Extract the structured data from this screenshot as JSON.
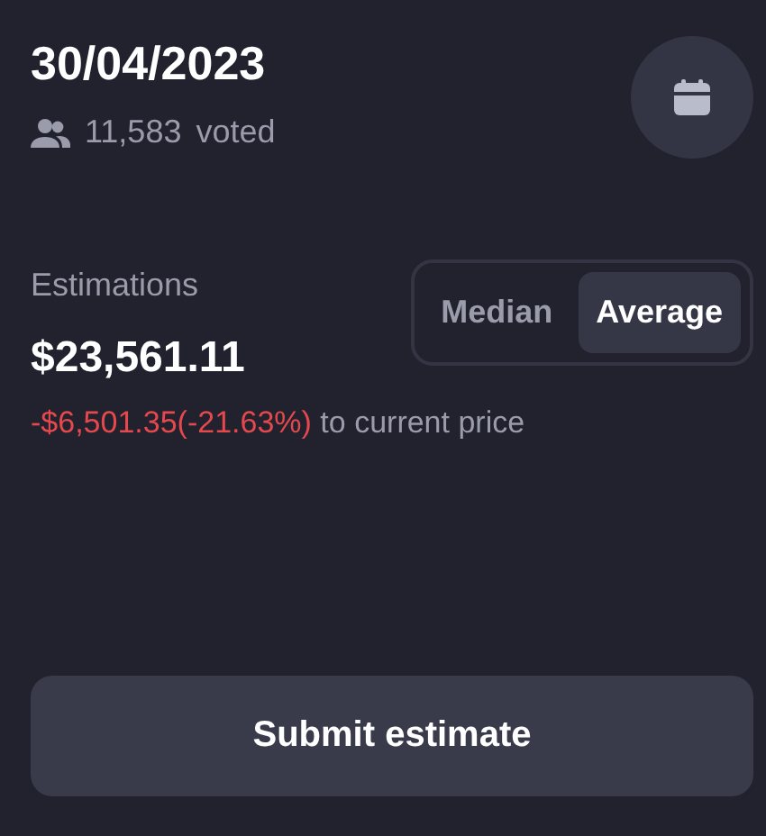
{
  "date": "30/04/2023",
  "voters": {
    "count": "11,583",
    "label": "voted"
  },
  "estimations": {
    "label": "Estimations",
    "value": "$23,561.11",
    "delta": "-$6,501.35(-21.63%)",
    "suffix": "to current price"
  },
  "modes": [
    {
      "label": "Median",
      "selected": false
    },
    {
      "label": "Average",
      "selected": true
    }
  ],
  "submit": "Submit estimate"
}
